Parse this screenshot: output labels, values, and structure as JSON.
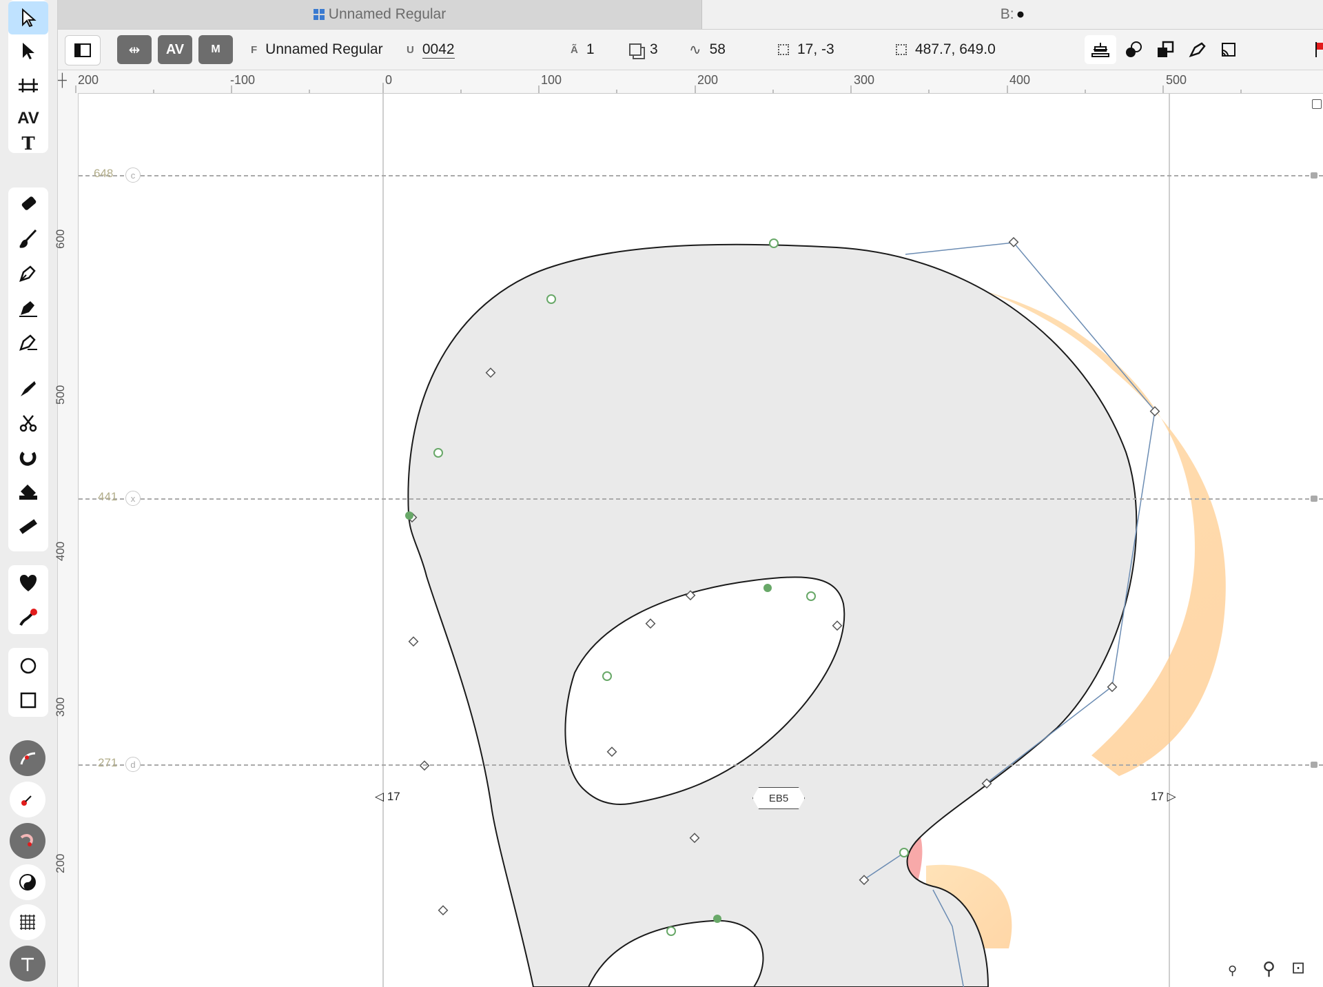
{
  "tabs": [
    {
      "label": "Unnamed Regular",
      "icon": "grid-icon"
    },
    {
      "label": "B:",
      "icon": "glyph-thumbnail-icon"
    }
  ],
  "infobar": {
    "font_key": "F",
    "font_name": "Unnamed Regular",
    "unicode_key": "U",
    "unicode": "0042",
    "layers_key": "Ã",
    "layers": "1",
    "contours": "3",
    "nodes": "58",
    "position": "17, -3",
    "dimensions": "487.7, 649.0"
  },
  "ruler": {
    "h_labels": [
      "200",
      "-100",
      "0",
      "100",
      "200",
      "300",
      "400",
      "500"
    ],
    "v_labels": [
      "600",
      "500",
      "400",
      "300",
      "200"
    ]
  },
  "guides": {
    "cap": {
      "value": "648",
      "tag": "c"
    },
    "x": {
      "value": "441",
      "tag": "x"
    },
    "d": {
      "value": "271",
      "tag": "d"
    }
  },
  "sidebearings": {
    "left": "17",
    "right": "17"
  },
  "glyph_label": "EB5",
  "colors": {
    "selection": "#bfe2ff",
    "fill": "#eaeaea",
    "guide_text": "#b2ad8a",
    "node_smooth": "#68a868",
    "handle_line": "#6b8cb3"
  },
  "icons": {
    "tools": [
      "pointer-icon",
      "contour-pointer-icon",
      "metrics-icon",
      "kerning-icon",
      "text-icon",
      "eraser-icon",
      "brush-icon",
      "pen-icon",
      "bezier-pen-icon",
      "rapid-pen-icon",
      "knife-icon",
      "scissors-icon",
      "magnet-icon",
      "fill-icon",
      "ruler-icon",
      "heart-shape-icon",
      "sketch-icon",
      "ellipse-icon",
      "rectangle-icon"
    ]
  }
}
